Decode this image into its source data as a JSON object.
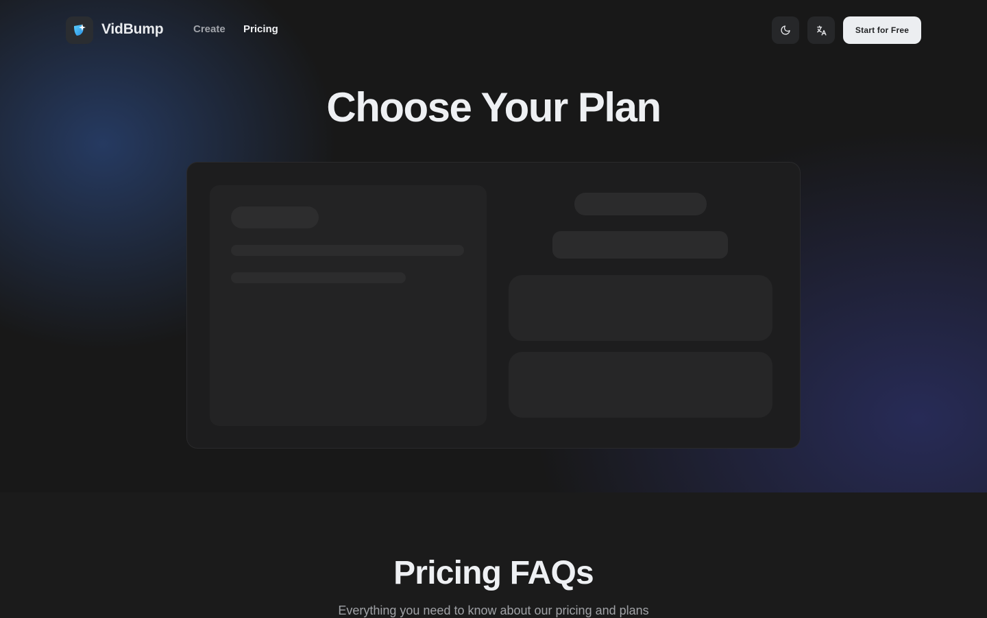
{
  "header": {
    "brand": "VidBump",
    "logo_icon": "sparkle-logo-icon",
    "nav": [
      {
        "label": "Create",
        "active": false
      },
      {
        "label": "Pricing",
        "active": true
      }
    ],
    "theme_toggle_icon": "moon-icon",
    "language_icon": "translate-icon",
    "cta_label": "Start for Free"
  },
  "hero": {
    "title": "Choose Your Plan",
    "loading": true
  },
  "faq": {
    "title": "Pricing FAQs",
    "subtitle": "Everything you need to know about our pricing and plans"
  },
  "colors": {
    "background": "#181818",
    "accent_blue": "#38b6f5",
    "cta_bg": "#eceef1"
  }
}
